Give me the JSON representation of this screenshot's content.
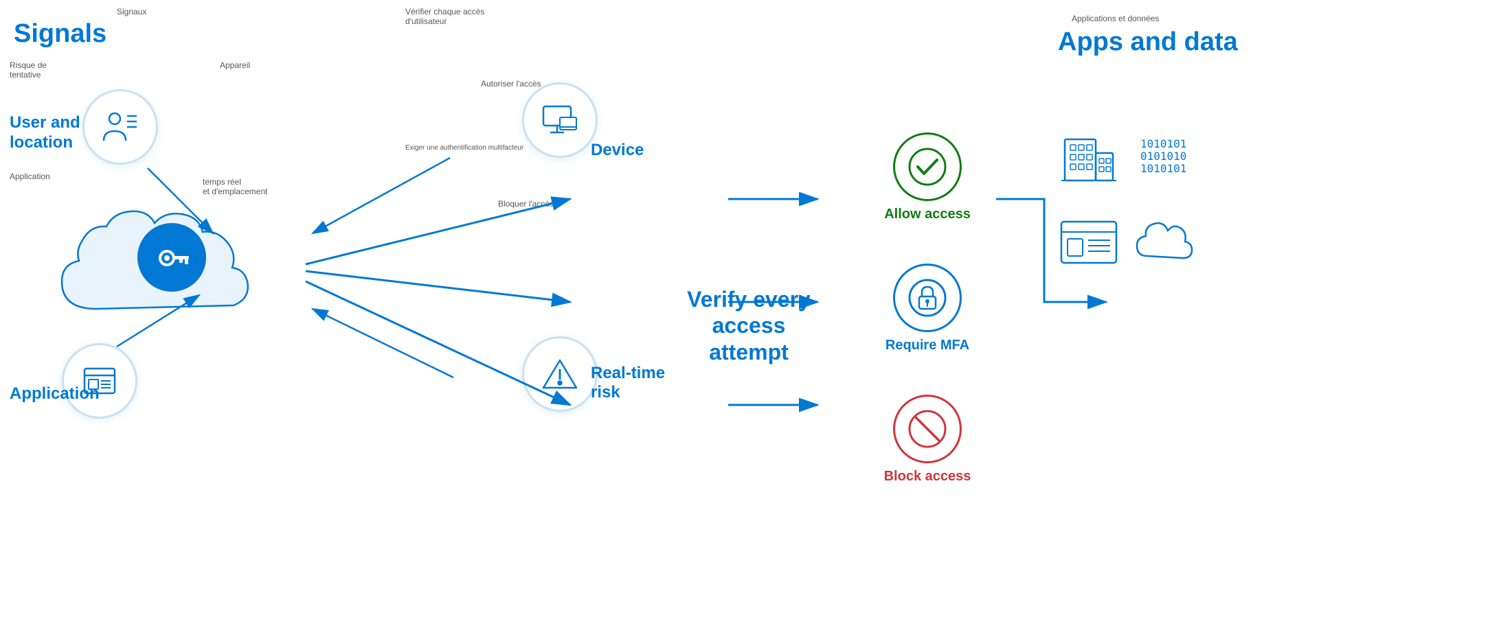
{
  "signals": {
    "fr_title": "Signaux",
    "en_title": "Signals",
    "fr_risque": "Risque de\ntentative",
    "fr_appareil": "Appareil",
    "fr_application": "Application",
    "fr_temps_reel": "temps réel\net d'emplacement",
    "label_user_location": "User and\nlocation",
    "label_application": "Application"
  },
  "verify_fr": {
    "fr_title": "Vérifier chaque accès\nd'utilisateur",
    "fr_autoriser": "Autoriser l'accès",
    "fr_exiger": "Exiger une authentification multifacteur",
    "fr_bloquer": "Bloquer l'accès",
    "label_device": "Device",
    "label_realtime": "Real-time\nrisk"
  },
  "verify_en": {
    "title_line1": "Verify every access",
    "title_line2": "attempt"
  },
  "access": {
    "allow_label": "Allow access",
    "mfa_label": "Require MFA",
    "block_label": "Block access"
  },
  "apps": {
    "fr_title": "Applications et données",
    "en_title": "Apps and data"
  }
}
